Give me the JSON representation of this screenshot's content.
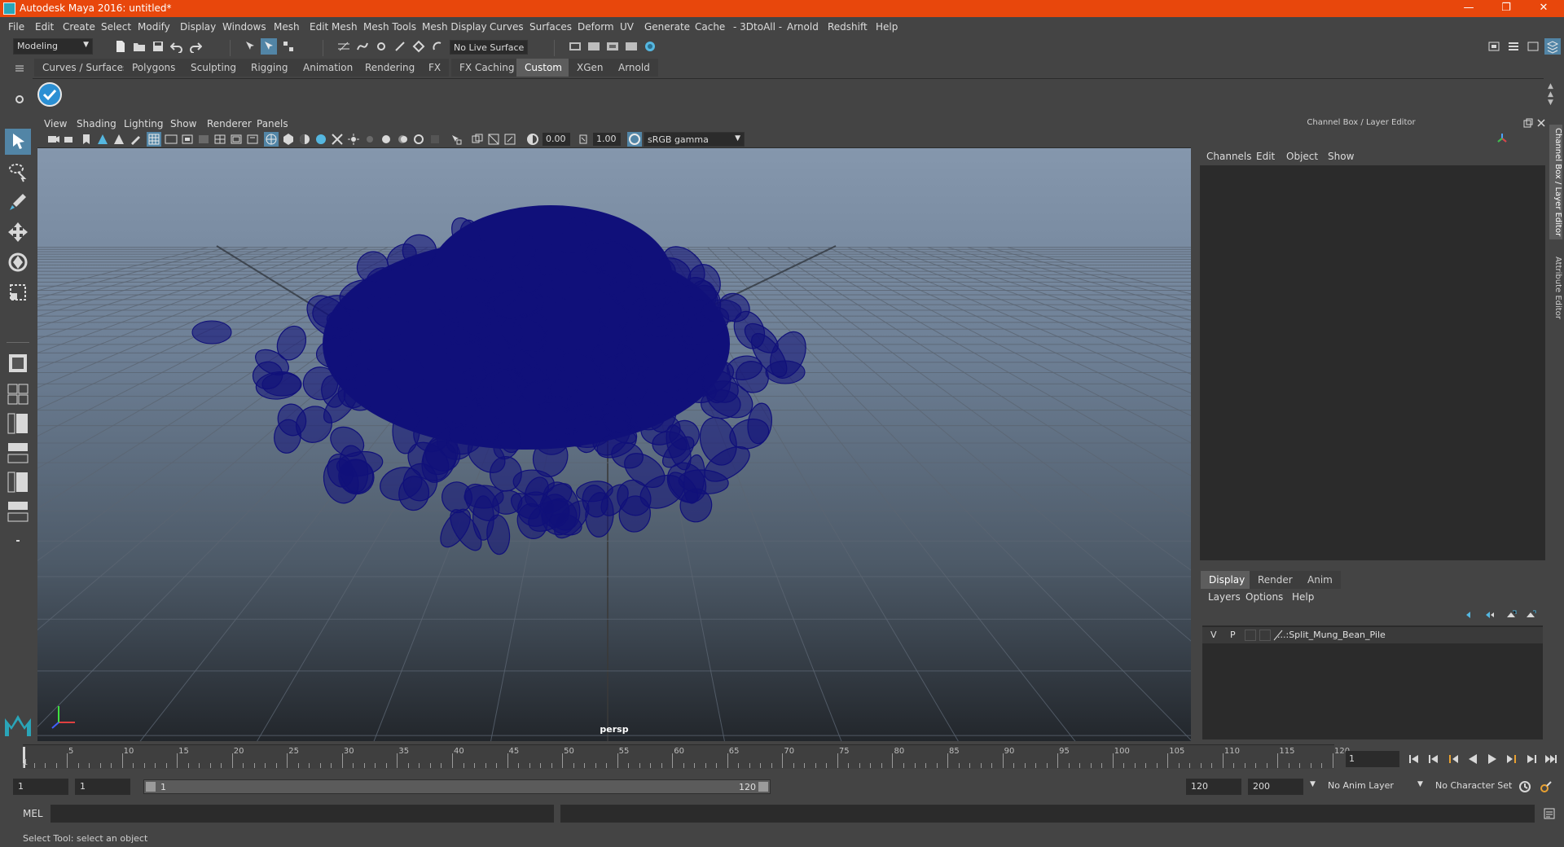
{
  "window": {
    "title": "Autodesk Maya 2016: untitled*",
    "minimize": "—",
    "restore": "❐",
    "close": "✕"
  },
  "menubar": [
    "File",
    "Edit",
    "Create",
    "Select",
    "Modify",
    "Display",
    "Windows",
    "Mesh",
    "Edit Mesh",
    "Mesh Tools",
    "Mesh Display",
    "Curves",
    "Surfaces",
    "Deform",
    "UV",
    "Generate",
    "Cache",
    "- 3DtoAll -",
    "Arnold",
    "Redshift",
    "Help"
  ],
  "statusline": {
    "menu_set": "Modeling",
    "live_surface": "No Live Surface"
  },
  "shelf_tabs": [
    "Curves / Surfaces",
    "Polygons",
    "Sculpting",
    "Rigging",
    "Animation",
    "Rendering",
    "FX",
    "FX Caching",
    "Custom",
    "XGen",
    "Arnold"
  ],
  "shelf_active": "Custom",
  "viewport": {
    "menu": [
      "View",
      "Shading",
      "Lighting",
      "Show",
      "Renderer",
      "Panels"
    ],
    "exposure": "0.00",
    "gamma": "1.00",
    "color_space": "sRGB gamma",
    "camera": "persp",
    "wire_color": "#10107a"
  },
  "right_panel": {
    "title": "Channel Box / Layer Editor",
    "channel_menu": [
      "Channels",
      "Edit",
      "Object",
      "Show"
    ],
    "layer_tabs": [
      "Display",
      "Render",
      "Anim"
    ],
    "layer_active": "Display",
    "layer_menu": [
      "Layers",
      "Options",
      "Help"
    ],
    "layers": [
      {
        "v": "V",
        "p": "P",
        "name": "...:Split_Mung_Bean_Pile"
      }
    ],
    "side_tabs": [
      "Channel Box / Layer Editor",
      "Attribute Editor"
    ]
  },
  "timeline": {
    "start_label": "1",
    "ticks": [
      "5",
      "10",
      "15",
      "20",
      "25",
      "30",
      "35",
      "40",
      "45",
      "50",
      "55",
      "60",
      "65",
      "70",
      "75",
      "80",
      "85",
      "90",
      "95",
      "100",
      "105",
      "110",
      "115",
      "120"
    ],
    "current_frame": "1"
  },
  "range": {
    "start": "1",
    "inner_start": "1",
    "slider_start": "1",
    "slider_end": "120",
    "end": "120",
    "outer_end": "200",
    "anim_layer": "No Anim Layer",
    "character_set": "No Character Set"
  },
  "command": {
    "mode": "MEL"
  },
  "help_line": "Select Tool: select an object"
}
